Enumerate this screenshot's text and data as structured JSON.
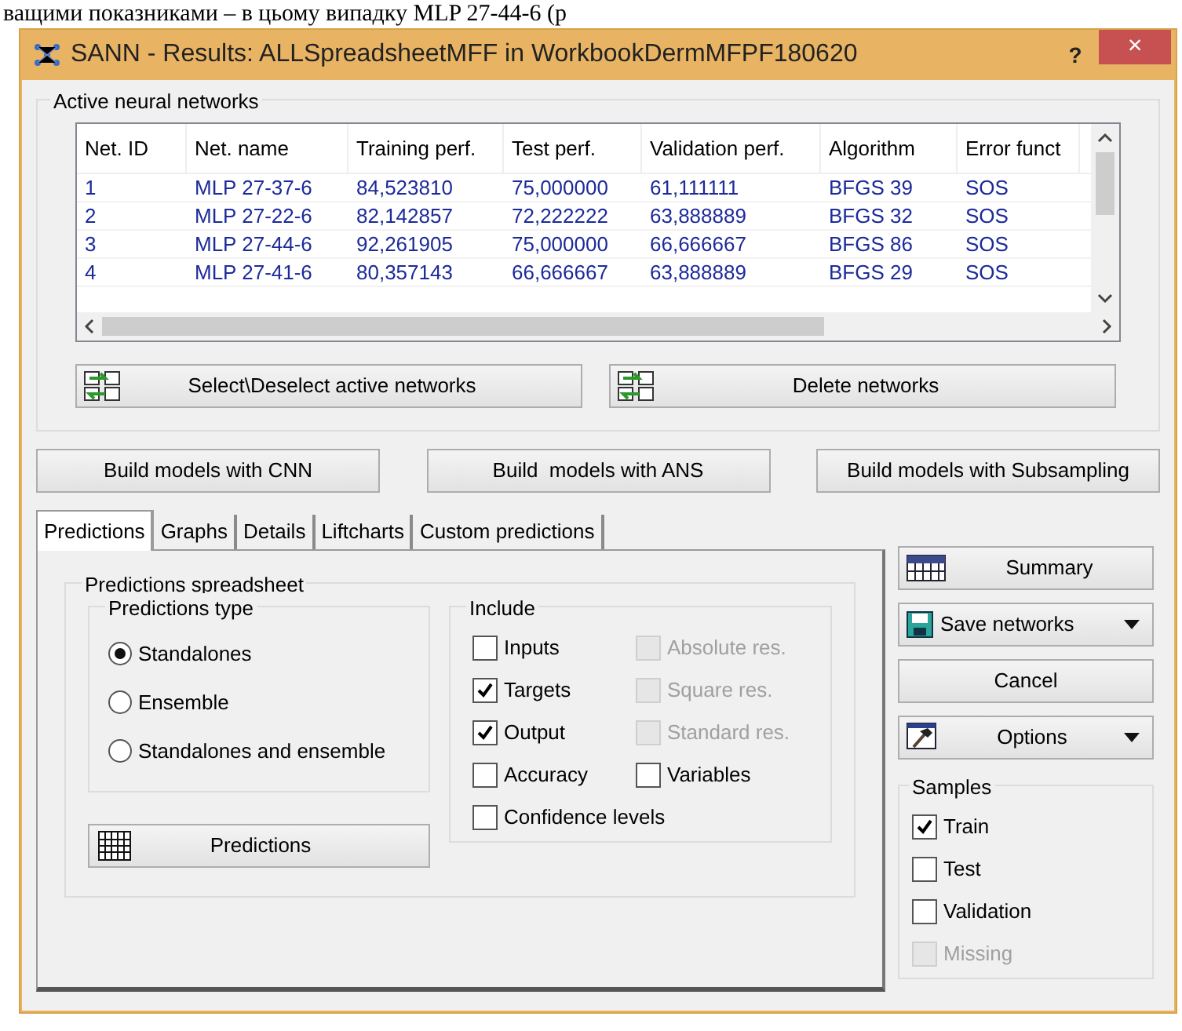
{
  "document_text": "ващими показниками – в цьому випадку MLP 27-44-6 (р",
  "window": {
    "title": "SANN - Results: ALLSpreadsheetMFF in WorkbookDermMFPF180620",
    "help": "?",
    "close": "×"
  },
  "networks": {
    "title": "Active neural networks",
    "columns": [
      "Net. ID",
      "Net. name",
      "Training perf.",
      "Test perf.",
      "Validation perf.",
      "Algorithm",
      "Error funct"
    ],
    "rows": [
      [
        "1",
        "MLP 27-37-6",
        "84,523810",
        "75,000000",
        "61,111111",
        "BFGS 39",
        "SOS"
      ],
      [
        "2",
        "MLP 27-22-6",
        "82,142857",
        "72,222222",
        "63,888889",
        "BFGS 32",
        "SOS"
      ],
      [
        "3",
        "MLP 27-44-6",
        "92,261905",
        "75,000000",
        "66,666667",
        "BFGS 86",
        "SOS"
      ],
      [
        "4",
        "MLP 27-41-6",
        "80,357143",
        "66,666667",
        "63,888889",
        "BFGS 29",
        "SOS"
      ]
    ]
  },
  "network_buttons": [
    "Select\\Deselect active networks",
    "Delete networks"
  ],
  "build_buttons": [
    "Build models with CNN",
    "Build  models with ANS",
    "Build models with Subsampling"
  ],
  "tabs": [
    {
      "label": "Predictions",
      "selected": true
    },
    {
      "label": "Graphs",
      "selected": false
    },
    {
      "label": "Details",
      "selected": false
    },
    {
      "label": "Liftcharts",
      "selected": false
    },
    {
      "label": "Custom predictions",
      "selected": false
    }
  ],
  "predictions": {
    "title": "Predictions spreadsheet",
    "type_group": {
      "title": "Predictions type",
      "options": [
        {
          "label": "Standalones",
          "selected": true
        },
        {
          "label": "Ensemble",
          "selected": false
        },
        {
          "label": "Standalones and ensemble",
          "selected": false
        }
      ]
    },
    "button": "Predictions",
    "include": {
      "title": "Include",
      "items": [
        {
          "label": "Inputs",
          "checked": false,
          "disabled": false
        },
        {
          "label": "Absolute res.",
          "checked": false,
          "disabled": true
        },
        {
          "label": "Targets",
          "checked": true,
          "disabled": false
        },
        {
          "label": "Square res.",
          "checked": false,
          "disabled": true
        },
        {
          "label": "Output",
          "checked": true,
          "disabled": false
        },
        {
          "label": "Standard res.",
          "checked": false,
          "disabled": true
        },
        {
          "label": "Accuracy",
          "checked": false,
          "disabled": false
        },
        {
          "label": "Variables",
          "checked": false,
          "disabled": false
        },
        {
          "label": "Confidence levels",
          "checked": false,
          "disabled": false
        }
      ]
    }
  },
  "side_buttons": [
    {
      "label": "Summary",
      "kind": "summary"
    },
    {
      "label": "Save networks",
      "kind": "save"
    },
    {
      "label": "Cancel",
      "kind": "plain"
    },
    {
      "label": "Options",
      "kind": "options"
    }
  ],
  "samples": {
    "title": "Samples",
    "items": [
      {
        "label": "Train",
        "checked": true,
        "disabled": false
      },
      {
        "label": "Test",
        "checked": false,
        "disabled": false
      },
      {
        "label": "Validation",
        "checked": false,
        "disabled": false
      },
      {
        "label": "Missing",
        "checked": false,
        "disabled": true
      }
    ]
  }
}
